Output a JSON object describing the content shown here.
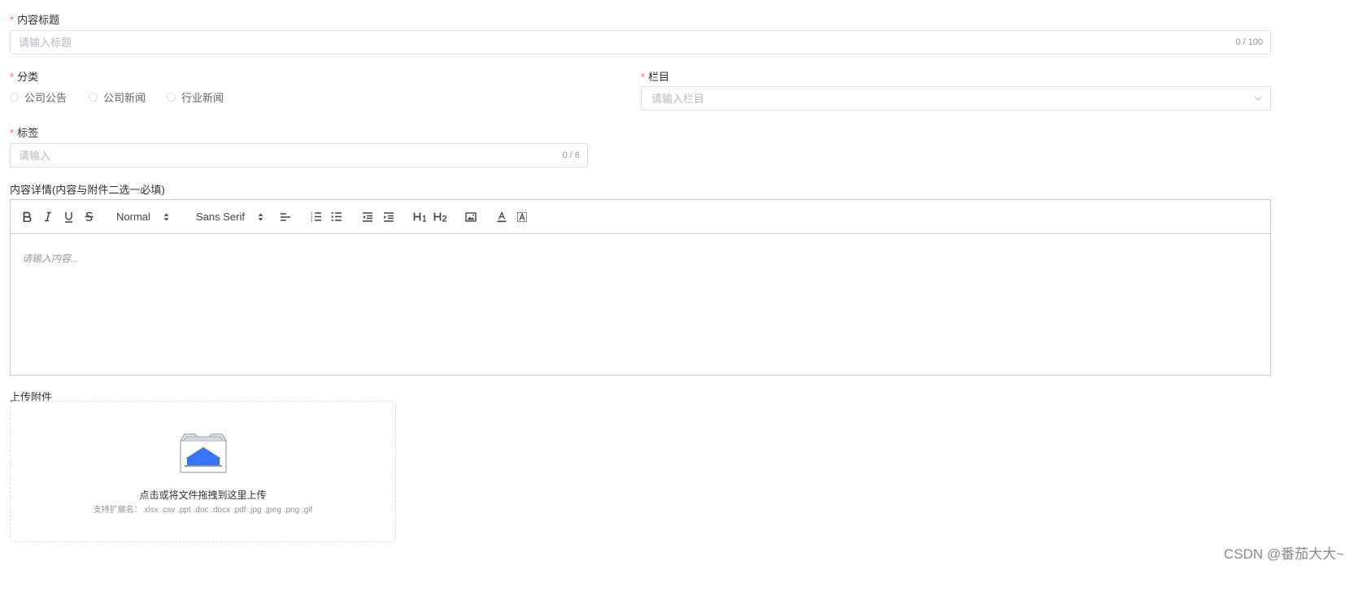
{
  "title_field": {
    "label": "内容标题",
    "placeholder": "请输入标题",
    "counter": "0 / 100"
  },
  "category": {
    "label": "分类",
    "options": [
      "公司公告",
      "公司新闻",
      "行业新闻"
    ]
  },
  "column": {
    "label": "栏目",
    "placeholder": "请输入栏目"
  },
  "tags": {
    "label": "标签",
    "placeholder": "请输入",
    "counter": "0 / 6"
  },
  "content": {
    "label": "内容详情(内容与附件二选一必填)",
    "header_picker": "Normal",
    "font_picker": "Sans Serif",
    "placeholder": "请输入内容..."
  },
  "attachment": {
    "label": "上传附件",
    "drop_text": "点击或将文件拖拽到这里上传",
    "tip": "支持扩展名：.xlsx .csv .ppt .doc .docx .pdf .jpg .jpeg .png .gif"
  },
  "watermark": "CSDN @番茄大大~",
  "colors": {
    "required": "#f56c6c",
    "upload_accent": "#3a73f5",
    "border": "#dcdfe6"
  }
}
